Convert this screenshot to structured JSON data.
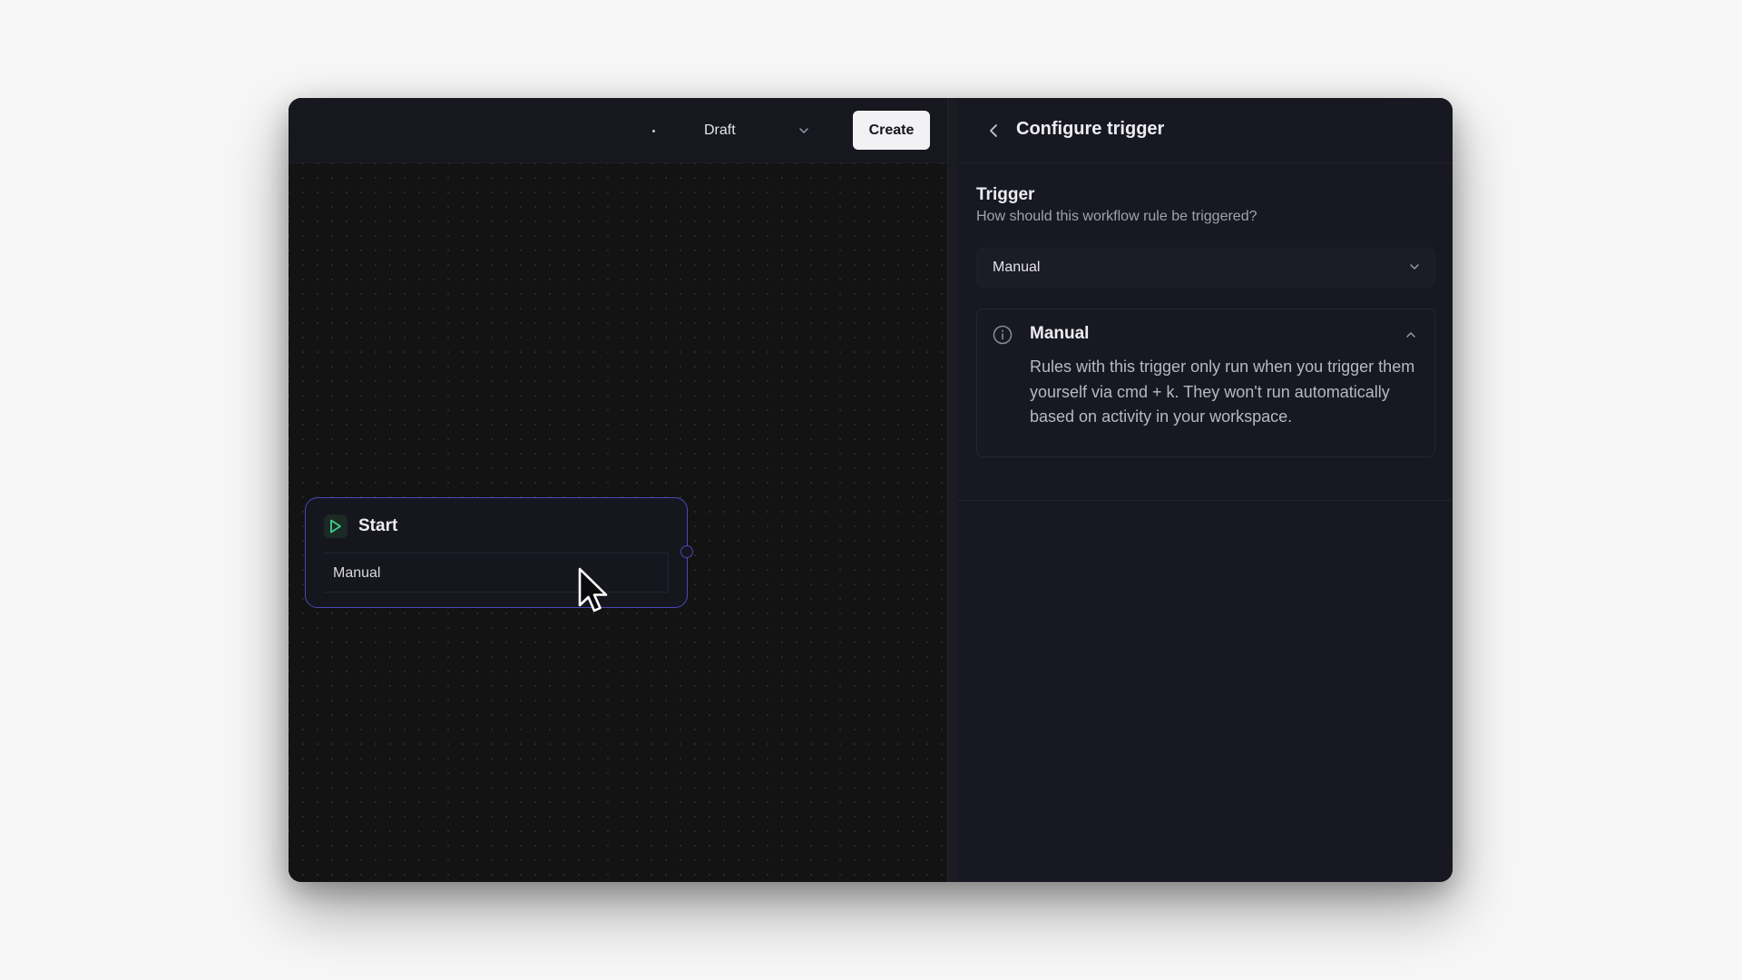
{
  "toolbar": {
    "more_icon": "more-horizontal-icon",
    "status_value": "Draft",
    "create_label": "Create"
  },
  "canvas": {
    "node": {
      "icon": "play-icon",
      "title": "Start",
      "trigger_value": "Manual"
    }
  },
  "panel": {
    "back_icon": "chevron-left-icon",
    "title": "Configure trigger",
    "section_title": "Trigger",
    "section_subtitle": "How should this workflow rule be triggered?",
    "trigger_select_value": "Manual",
    "info_card": {
      "icon": "info-icon",
      "title": "Manual",
      "description": "Rules with this trigger only run when you trigger them yourself via cmd + k. They won't run automatically based on activity in your workspace."
    }
  },
  "colors": {
    "accent": "#4c46b8",
    "play_green": "#3ecf8e",
    "background": "#f7f7f8",
    "panel_bg": "#181823",
    "canvas_bg": "#131313"
  }
}
